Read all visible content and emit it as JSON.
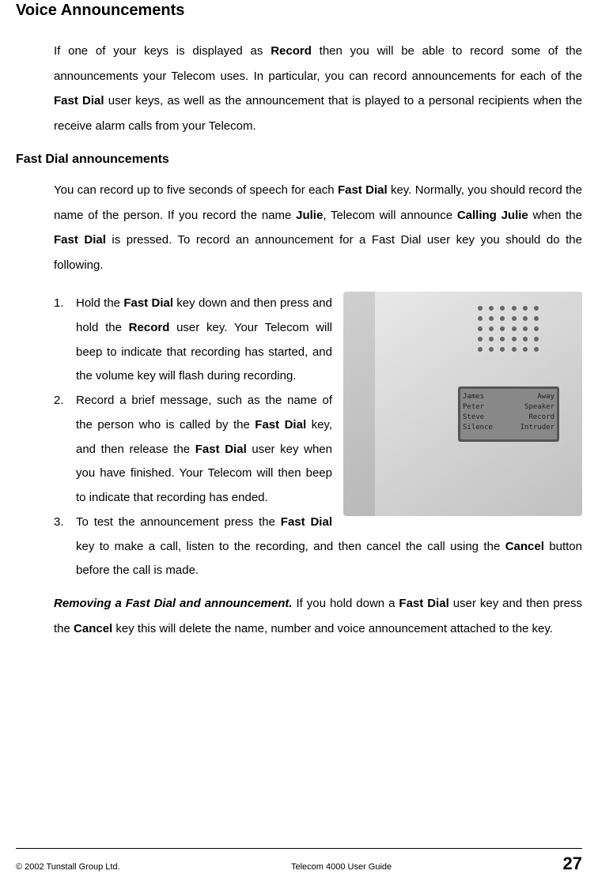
{
  "section_title": "Voice Announcements",
  "intro": {
    "pre1": "If one of your keys is displayed as ",
    "b1": "Record",
    "mid1": " then you will be able to record some of the announcements your Telecom uses. In particular, you can record announcements for each of the ",
    "b2": "Fast Dial",
    "post1": " user keys, as well as the announcement that is played to a personal recipients when the receive alarm calls from your Telecom."
  },
  "subsection_title": "Fast Dial announcements",
  "sub_intro": {
    "pre": "You can record up to five seconds of speech for each ",
    "b1": "Fast Dial",
    "mid1": " key. Normally, you should record the name of the person. If you record the name ",
    "b2": "Julie",
    "mid2": ", Telecom will announce ",
    "b3": "Calling Julie",
    "mid3": " when the ",
    "b4": "Fast Dial",
    "post": " is pressed. To record an announcement for a Fast Dial user key you should do the following."
  },
  "steps": [
    {
      "num": "1.",
      "parts": [
        "Hold the ",
        {
          "b": "Fast Dial"
        },
        " key down and then press and hold the ",
        {
          "b": "Record"
        },
        " user key. Your Telecom will beep  to indicate that recording has started, and the volume key will flash during recording."
      ]
    },
    {
      "num": "2.",
      "parts": [
        "Record a brief message, such as the name of the person who is called by the ",
        {
          "b": "Fast Dial"
        },
        " key, and then release the ",
        {
          "b": "Fast Dial"
        },
        " user key when you have finished. Your Telecom will then beep to indicate that recording has ended."
      ]
    },
    {
      "num": "3.",
      "parts": [
        "To test the announcement press the ",
        {
          "b": "Fast Dial"
        },
        " key to make a call, listen to the recording, and then cancel the call using the ",
        {
          "b": "Cancel"
        },
        " button before the call is made."
      ]
    }
  ],
  "device_screen": [
    [
      "James",
      "Away"
    ],
    [
      "Peter",
      "Speaker"
    ],
    [
      "Steve",
      "Record"
    ],
    [
      "Silence",
      "Intruder"
    ]
  ],
  "removing": {
    "title": "Removing a Fast Dial and announcement.",
    "pre": " If you hold down a ",
    "b1": "Fast Dial",
    "mid1": " user key and then press the ",
    "b2": "Cancel",
    "post": " key this will delete the name, number and voice announcement attached to the key."
  },
  "footer": {
    "left": "© 2002 Tunstall Group Ltd.",
    "center": "Telecom 4000 User Guide",
    "right": "27"
  }
}
